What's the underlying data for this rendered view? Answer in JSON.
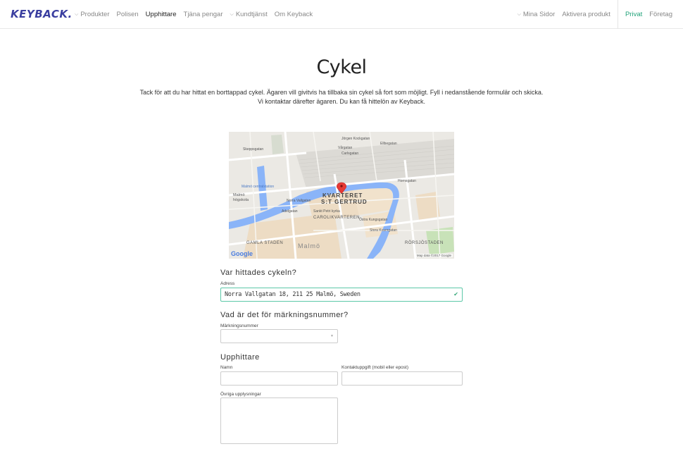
{
  "nav": {
    "logo": "KEYBACK.",
    "items": [
      {
        "label": "Produkter",
        "dropdown": true
      },
      {
        "label": "Polisen",
        "dropdown": false
      },
      {
        "label": "Upphittare",
        "dropdown": false,
        "active": true
      },
      {
        "label": "Tjäna pengar",
        "dropdown": false
      },
      {
        "label": "Kundtjänst",
        "dropdown": true
      },
      {
        "label": "Om Keyback",
        "dropdown": false
      }
    ],
    "right": {
      "mina_sidor": "Mina Sidor",
      "aktivera": "Aktivera produkt",
      "privat": "Privat",
      "foretag": "Företag"
    }
  },
  "page": {
    "title": "Cykel",
    "intro": "Tack för att du har hittat en borttappad cykel. Ägaren vill givitvis ha tillbaka sin cykel så fort som möjligt. Fyll i nedanstående formulär och skicka. Vi kontaktar därefter ägaren. Du kan få hittelön av Keyback."
  },
  "map": {
    "labels": {
      "jorgen": "Jörgen Kockgatan",
      "ellbegatan": "Ellbegatan",
      "vargatan": "Vårgatan",
      "carlsgatan": "Carlsgatan",
      "skeppsgatan": "Skeppsgatan",
      "centralstation": "Malmö centralstation",
      "hogskola1": "Malmö",
      "hogskola2": "högskola",
      "kvarteret1": "KVARTERET",
      "kvarteret2": "S:T GERTRUD",
      "norra": "Norra Vallgatan",
      "sankt": "Sankt Petri kyrka",
      "carolik": "CAROLIKVARTEREN",
      "adelgatan": "Adelgatan",
      "kungsgatan": "Östra Kungsgatan",
      "stora": "Stora Kvarngatan",
      "homegatan": "Hornsgatan",
      "gamla": "GAMLA STADEN",
      "malmo": "Malmö",
      "rorsjo": "RÖRSJÖSTADEN",
      "google": "Google",
      "mapdata": "Map data ©2017 Google"
    }
  },
  "form": {
    "q1": "Var hittades cykeln?",
    "adress_label": "Adress",
    "adress_value": "Norra Vallgatan 18, 211 25 Malmö, Sweden",
    "q2": "Vad är det för märkningsnummer?",
    "marknings_label": "Märkningsnummer",
    "q3": "Upphittare",
    "namn_label": "Namn",
    "kontakt_label": "Kontaktuppgift (mobil eller epost)",
    "ovriga_label": "Övriga upplysningar"
  },
  "colors": {
    "brand": "#3b3fa0",
    "accent": "#22a37a",
    "valid_border": "#5cc8a8",
    "water": "#8ab4f8",
    "marker": "#e53935"
  },
  "icons": {
    "dropdown": "chevron-down-icon",
    "valid": "check-icon",
    "select": "caret-down-icon",
    "marker": "map-marker-icon"
  }
}
